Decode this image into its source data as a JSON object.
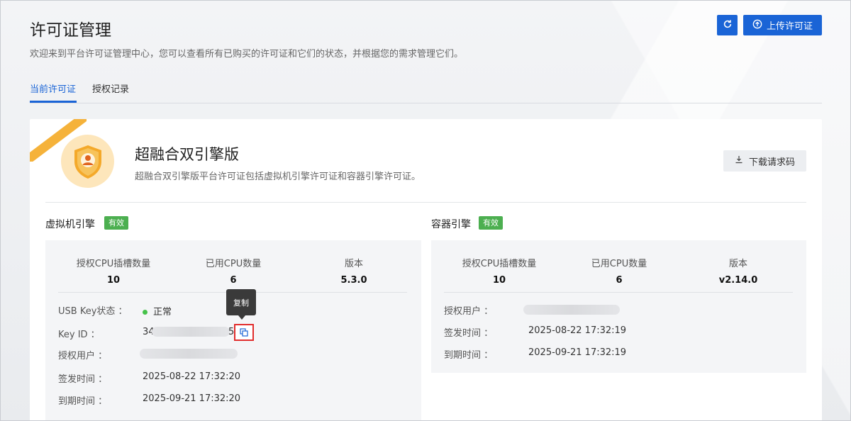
{
  "header": {
    "title": "许可证管理",
    "description": "欢迎来到平台许可证管理中心，您可以查看所有已购买的许可证和它们的状态，并根据您的需求管理它们。",
    "refresh_icon": "refresh-icon",
    "upload_label": "上传许可证"
  },
  "tabs": [
    {
      "label": "当前许可证",
      "active": true
    },
    {
      "label": "授权记录",
      "active": false
    }
  ],
  "license": {
    "name": "超融合双引擎版",
    "description": "超融合双引擎版平台许可证包括虚拟机引擎许可证和容器引擎许可证。",
    "download_label": "下载请求码"
  },
  "vm_engine": {
    "title": "虚拟机引擎",
    "status": "有效",
    "stats": [
      {
        "label": "授权CPU插槽数量",
        "value": "10"
      },
      {
        "label": "已用CPU数量",
        "value": "6"
      },
      {
        "label": "版本",
        "value": "5.3.0"
      }
    ],
    "usb_key_label": "USB Key状态 ：",
    "usb_key_value": "正常",
    "key_id_label": "Key ID ：",
    "key_id_prefix": "34",
    "key_id_suffix": "5",
    "user_label": "授权用户 ：",
    "issued_label": "签发时间 ：",
    "issued_value": "2025-08-22 17:32:20",
    "expire_label": "到期时间 ：",
    "expire_value": "2025-09-21 17:32:20",
    "copy_tooltip": "复制"
  },
  "container_engine": {
    "title": "容器引擎",
    "status": "有效",
    "stats": [
      {
        "label": "授权CPU插槽数量",
        "value": "10"
      },
      {
        "label": "已用CPU数量",
        "value": "6"
      },
      {
        "label": "版本",
        "value": "v2.14.0"
      }
    ],
    "user_label": "授权用户 ：",
    "issued_label": "签发时间 ：",
    "issued_value": "2025-08-22 17:32:19",
    "expire_label": "到期时间 ：",
    "expire_value": "2025-09-21 17:32:19"
  },
  "colors": {
    "primary": "#1a64d6",
    "valid_tag": "#4caf50",
    "ribbon": "#f5b23a",
    "highlight_border": "#e12d2d"
  }
}
